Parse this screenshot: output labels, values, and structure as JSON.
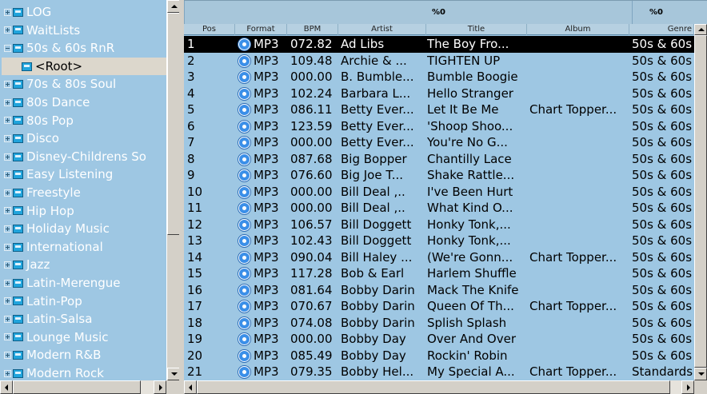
{
  "tree": {
    "items": [
      {
        "label": "LOG",
        "expanded": false
      },
      {
        "label": "WaitLists",
        "expanded": false
      },
      {
        "label": "50s & 60s RnR",
        "expanded": true
      },
      {
        "label": "<Root>",
        "child": true,
        "selected": true
      },
      {
        "label": "70s & 80s Soul",
        "expanded": false
      },
      {
        "label": "80s Dance",
        "expanded": false
      },
      {
        "label": "80s Pop",
        "expanded": false
      },
      {
        "label": "Disco",
        "expanded": false
      },
      {
        "label": "Disney-Childrens So",
        "expanded": false
      },
      {
        "label": "Easy Listening",
        "expanded": false
      },
      {
        "label": "Freestyle",
        "expanded": false
      },
      {
        "label": "Hip Hop",
        "expanded": false
      },
      {
        "label": "Holiday Music",
        "expanded": false
      },
      {
        "label": "International",
        "expanded": false
      },
      {
        "label": "Jazz",
        "expanded": false
      },
      {
        "label": "Latin-Merengue",
        "expanded": false
      },
      {
        "label": "Latin-Pop",
        "expanded": false
      },
      {
        "label": "Latin-Salsa",
        "expanded": false
      },
      {
        "label": "Lounge Music",
        "expanded": false
      },
      {
        "label": "Modern R&B",
        "expanded": false
      },
      {
        "label": "Modern Rock",
        "expanded": false
      }
    ]
  },
  "grid": {
    "percent_labels": [
      "%0",
      "%0"
    ],
    "columns": [
      "Pos",
      "Format",
      "BPM",
      "Artist",
      "Title",
      "Album",
      "Genre"
    ],
    "rows": [
      {
        "pos": "1",
        "format": "MP3",
        "bpm": "072.82",
        "artist": "Ad Libs",
        "title": "The Boy Fro...",
        "album": "",
        "genre": "50s & 60s",
        "selected": true
      },
      {
        "pos": "2",
        "format": "MP3",
        "bpm": "109.48",
        "artist": "Archie & ...",
        "title": "TIGHTEN UP",
        "album": "",
        "genre": "50s & 60s"
      },
      {
        "pos": "3",
        "format": "MP3",
        "bpm": "000.00",
        "artist": "B. Bumble...",
        "title": "Bumble Boogie",
        "album": "",
        "genre": "50s & 60s"
      },
      {
        "pos": "4",
        "format": "MP3",
        "bpm": "102.24",
        "artist": "Barbara L...",
        "title": "Hello Stranger",
        "album": "",
        "genre": "50s & 60s"
      },
      {
        "pos": "5",
        "format": "MP3",
        "bpm": "086.11",
        "artist": "Betty Ever...",
        "title": "Let It Be Me",
        "album": "Chart Topper...",
        "genre": "50s & 60s"
      },
      {
        "pos": "6",
        "format": "MP3",
        "bpm": "123.59",
        "artist": "Betty Ever...",
        "title": "'Shoop Shoo...",
        "album": "",
        "genre": "50s & 60s"
      },
      {
        "pos": "7",
        "format": "MP3",
        "bpm": "000.00",
        "artist": "Betty Ever...",
        "title": "You're No G...",
        "album": "",
        "genre": "50s & 60s"
      },
      {
        "pos": "8",
        "format": "MP3",
        "bpm": "087.68",
        "artist": "Big Bopper",
        "title": "Chantilly Lace",
        "album": "",
        "genre": "50s & 60s"
      },
      {
        "pos": "9",
        "format": "MP3",
        "bpm": "076.60",
        "artist": "Big Joe T...",
        "title": "Shake Rattle...",
        "album": "",
        "genre": "50s & 60s"
      },
      {
        "pos": "10",
        "format": "MP3",
        "bpm": "000.00",
        "artist": "Bill Deal ,..",
        "title": "I've Been Hurt",
        "album": "",
        "genre": "50s & 60s"
      },
      {
        "pos": "11",
        "format": "MP3",
        "bpm": "000.00",
        "artist": "Bill Deal ,..",
        "title": "What Kind O...",
        "album": "",
        "genre": "50s & 60s"
      },
      {
        "pos": "12",
        "format": "MP3",
        "bpm": "106.57",
        "artist": "Bill Doggett",
        "title": "Honky Tonk,...",
        "album": "",
        "genre": "50s & 60s"
      },
      {
        "pos": "13",
        "format": "MP3",
        "bpm": "102.43",
        "artist": "Bill Doggett",
        "title": "Honky Tonk,...",
        "album": "",
        "genre": "50s & 60s"
      },
      {
        "pos": "14",
        "format": "MP3",
        "bpm": "090.04",
        "artist": "Bill Haley ...",
        "title": "(We're Gonn...",
        "album": "Chart Topper...",
        "genre": "50s & 60s"
      },
      {
        "pos": "15",
        "format": "MP3",
        "bpm": "117.28",
        "artist": "Bob & Earl",
        "title": "Harlem Shuffle",
        "album": "",
        "genre": "50s & 60s"
      },
      {
        "pos": "16",
        "format": "MP3",
        "bpm": "081.64",
        "artist": "Bobby Darin",
        "title": "Mack The Knife",
        "album": "",
        "genre": "50s & 60s"
      },
      {
        "pos": "17",
        "format": "MP3",
        "bpm": "070.67",
        "artist": "Bobby Darin",
        "title": "Queen Of Th...",
        "album": "Chart Topper...",
        "genre": "50s & 60s"
      },
      {
        "pos": "18",
        "format": "MP3",
        "bpm": "074.08",
        "artist": "Bobby Darin",
        "title": "Splish Splash",
        "album": "",
        "genre": "50s & 60s"
      },
      {
        "pos": "19",
        "format": "MP3",
        "bpm": "000.00",
        "artist": "Bobby Day",
        "title": "Over And Over",
        "album": "",
        "genre": "50s & 60s"
      },
      {
        "pos": "20",
        "format": "MP3",
        "bpm": "085.49",
        "artist": "Bobby Day",
        "title": "Rockin' Robin",
        "album": "",
        "genre": "50s & 60s"
      },
      {
        "pos": "21",
        "format": "MP3",
        "bpm": "079.35",
        "artist": "Bobby Hel...",
        "title": "My Special A...",
        "album": "Chart Topper...",
        "genre": "Standards"
      }
    ]
  },
  "icons": {
    "folder": "folder-icon",
    "audio": "audio-file-icon",
    "expand": "expand-toggle-icon"
  },
  "colors": {
    "panel_bg": "#9ec7e3",
    "selected_row": "#000000",
    "selected_tree": "#dcd7cc",
    "window": "#d4d0c8"
  }
}
